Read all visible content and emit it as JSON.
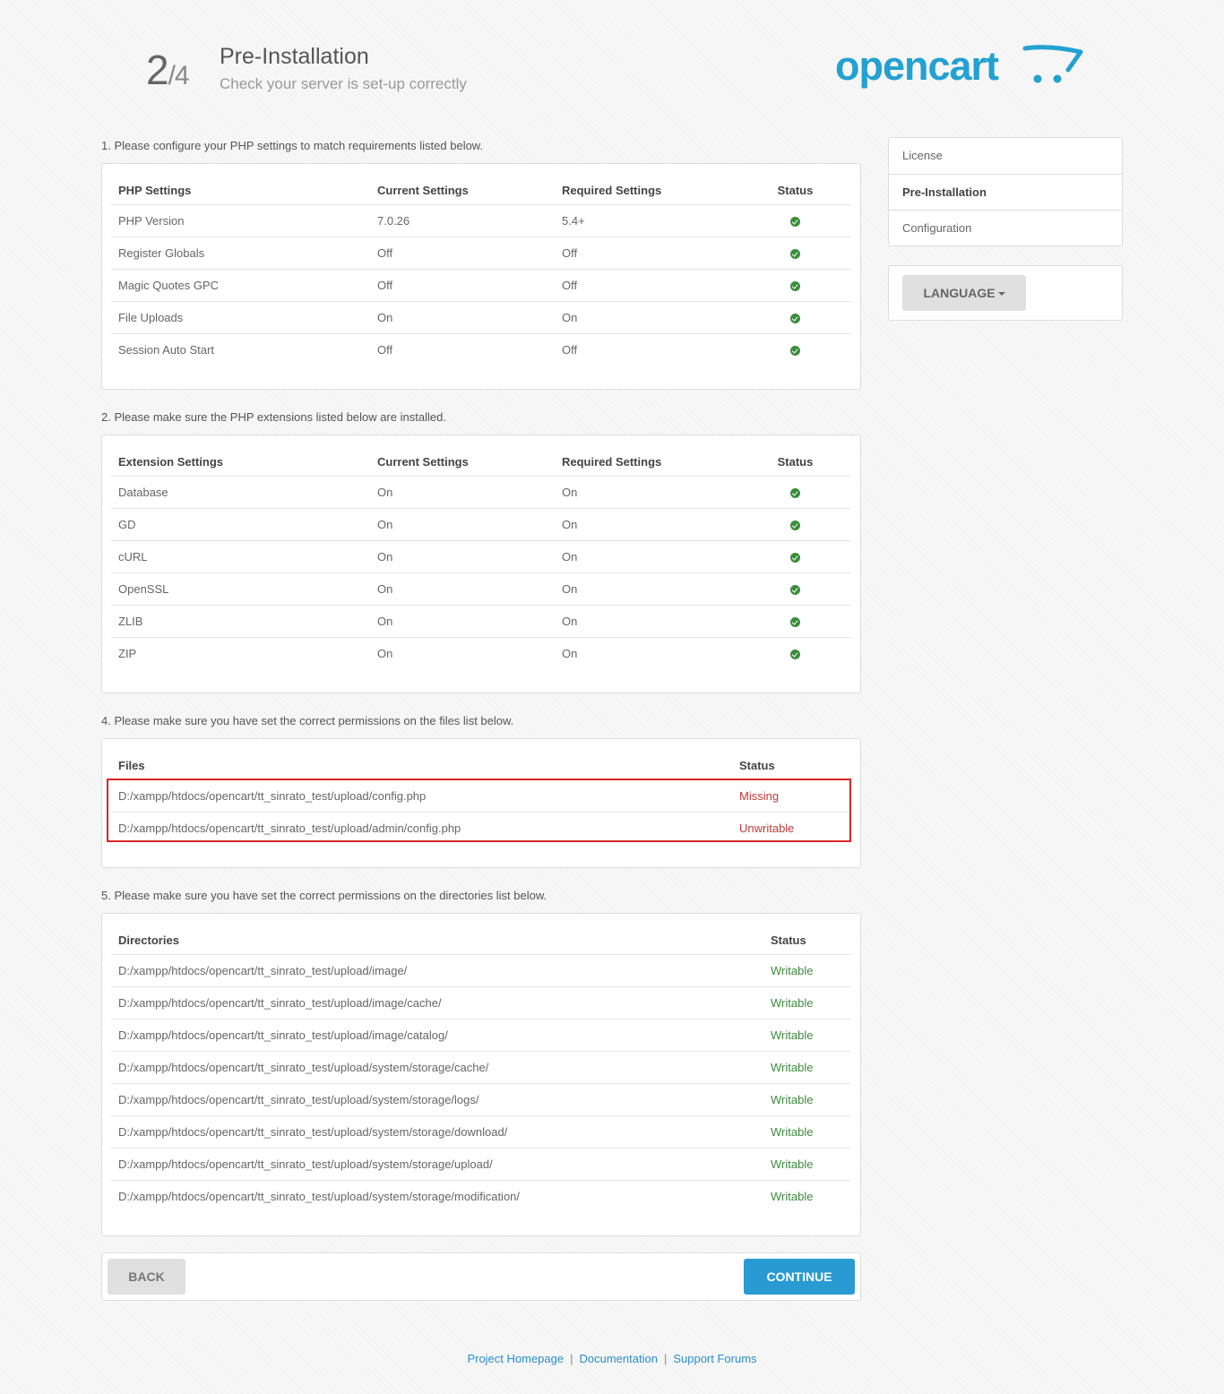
{
  "header": {
    "step_current": "2",
    "step_total": "/4",
    "title": "Pre-Installation",
    "subtitle": "Check your server is set-up correctly",
    "logo_text": "opencart",
    "brand_color": "#23a1d1"
  },
  "php": {
    "section_title": "1. Please configure your PHP settings to match requirements listed below.",
    "headers": [
      "PHP Settings",
      "Current Settings",
      "Required Settings",
      "Status"
    ],
    "rows": [
      {
        "name": "PHP Version",
        "current": "7.0.26",
        "required": "5.4+",
        "status": "ok-icon"
      },
      {
        "name": "Register Globals",
        "current": "Off",
        "required": "Off",
        "status": "ok-icon"
      },
      {
        "name": "Magic Quotes GPC",
        "current": "Off",
        "required": "Off",
        "status": "ok-icon"
      },
      {
        "name": "File Uploads",
        "current": "On",
        "required": "On",
        "status": "ok-icon"
      },
      {
        "name": "Session Auto Start",
        "current": "Off",
        "required": "Off",
        "status": "ok-icon"
      }
    ]
  },
  "extensions": {
    "section_title": "2. Please make sure the PHP extensions listed below are installed.",
    "headers": [
      "Extension Settings",
      "Current Settings",
      "Required Settings",
      "Status"
    ],
    "rows": [
      {
        "name": "Database",
        "current": "On",
        "required": "On",
        "status": "ok-icon"
      },
      {
        "name": "GD",
        "current": "On",
        "required": "On",
        "status": "ok-icon"
      },
      {
        "name": "cURL",
        "current": "On",
        "required": "On",
        "status": "ok-icon"
      },
      {
        "name": "OpenSSL",
        "current": "On",
        "required": "On",
        "status": "ok-icon"
      },
      {
        "name": "ZLIB",
        "current": "On",
        "required": "On",
        "status": "ok-icon"
      },
      {
        "name": "ZIP",
        "current": "On",
        "required": "On",
        "status": "ok-icon"
      }
    ]
  },
  "files": {
    "section_title": "4. Please make sure you have set the correct permissions on the files list below.",
    "headers": [
      "Files",
      "Status"
    ],
    "rows": [
      {
        "path": "D:/xampp/htdocs/opencart/tt_sinrato_test/upload/config.php",
        "status": "Missing"
      },
      {
        "path": "D:/xampp/htdocs/opencart/tt_sinrato_test/upload/admin/config.php",
        "status": "Unwritable"
      }
    ],
    "highlight_color": "#d9262a"
  },
  "directories": {
    "section_title": "5. Please make sure you have set the correct permissions on the directories list below.",
    "headers": [
      "Directories",
      "Status"
    ],
    "rows": [
      {
        "path": "D:/xampp/htdocs/opencart/tt_sinrato_test/upload/image/",
        "status": "Writable"
      },
      {
        "path": "D:/xampp/htdocs/opencart/tt_sinrato_test/upload/image/cache/",
        "status": "Writable"
      },
      {
        "path": "D:/xampp/htdocs/opencart/tt_sinrato_test/upload/image/catalog/",
        "status": "Writable"
      },
      {
        "path": "D:/xampp/htdocs/opencart/tt_sinrato_test/upload/system/storage/cache/",
        "status": "Writable"
      },
      {
        "path": "D:/xampp/htdocs/opencart/tt_sinrato_test/upload/system/storage/logs/",
        "status": "Writable"
      },
      {
        "path": "D:/xampp/htdocs/opencart/tt_sinrato_test/upload/system/storage/download/",
        "status": "Writable"
      },
      {
        "path": "D:/xampp/htdocs/opencart/tt_sinrato_test/upload/system/storage/upload/",
        "status": "Writable"
      },
      {
        "path": "D:/xampp/htdocs/opencart/tt_sinrato_test/upload/system/storage/modification/",
        "status": "Writable"
      }
    ]
  },
  "buttons": {
    "back": "BACK",
    "continue": "CONTINUE",
    "continue_color": "#2a9bd2"
  },
  "sidebar": {
    "steps": [
      {
        "label": "License",
        "active": false
      },
      {
        "label": "Pre-Installation",
        "active": true
      },
      {
        "label": "Configuration",
        "active": false
      }
    ],
    "language_label": "LANGUAGE"
  },
  "footer": {
    "links": [
      "Project Homepage",
      "Documentation",
      "Support Forums"
    ],
    "separator": "|"
  },
  "status_colors": {
    "ok": "#3b8c3b",
    "error": "#c43a3a",
    "writable": "#3e8b3e"
  }
}
